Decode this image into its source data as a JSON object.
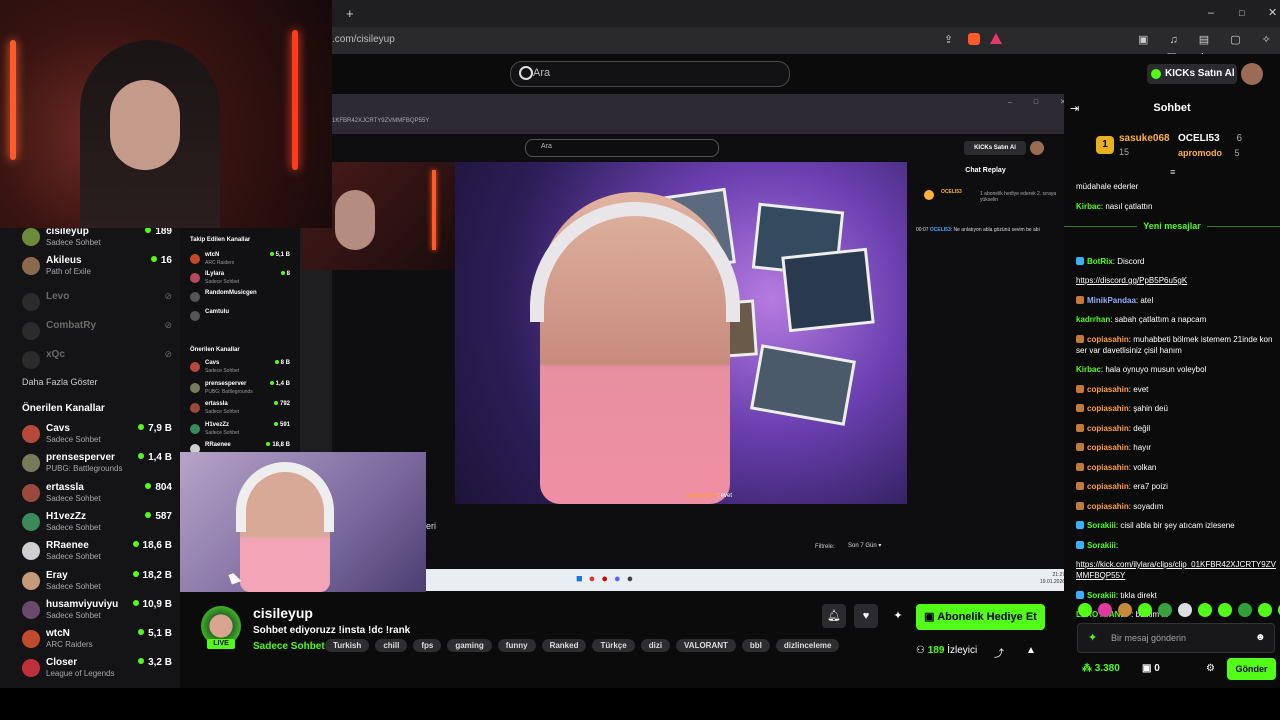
{
  "browser": {
    "url": ".com/cisileyup",
    "win_controls": [
      "–",
      "□",
      "✕"
    ]
  },
  "header": {
    "search_placeholder": "Ara",
    "kicks_label": "KICKs Satın Al"
  },
  "sidebar": {
    "top": [
      {
        "name": "cisileyup",
        "sub": "Sadece Sohbet",
        "count": "189",
        "color": "#6b8a3a"
      },
      {
        "name": "Akileus",
        "sub": "Path of Exile",
        "count": "16",
        "color": "#8a6a4a"
      }
    ],
    "offline": [
      {
        "name": "Levo"
      },
      {
        "name": "CombatRy"
      },
      {
        "name": "xQc"
      }
    ],
    "show_more": "Daha Fazla Göster",
    "recommended_title": "Önerilen Kanallar",
    "recommended": [
      {
        "name": "Cavs",
        "sub": "Sadece Sohbet",
        "count": "7,9 B",
        "color": "#b54a3a"
      },
      {
        "name": "prensesperver",
        "sub": "PUBG: Battlegrounds",
        "count": "1,4 B",
        "color": "#7a7a5a"
      },
      {
        "name": "ertassla",
        "sub": "Sadece Sohbet",
        "count": "804",
        "color": "#9a4a3a"
      },
      {
        "name": "H1vezZz",
        "sub": "Sadece Sohbet",
        "count": "587",
        "color": "#3a8a5a"
      },
      {
        "name": "RRaenee",
        "sub": "Sadece Sohbet",
        "count": "18,6 B",
        "color": "#cfcfcf"
      },
      {
        "name": "Eray",
        "sub": "Sadece Sohbet",
        "count": "18,2 B",
        "color": "#c49a7a"
      },
      {
        "name": "husamviyuviyu",
        "sub": "Sadece Sohbet",
        "count": "10,9 B",
        "color": "#6a4a6a"
      },
      {
        "name": "wtcN",
        "sub": "ARC Raiders",
        "count": "5,1 B",
        "color": "#c04a2a"
      },
      {
        "name": "Closer",
        "sub": "League of Legends",
        "count": "3,2 B",
        "color": "#c0303a"
      }
    ]
  },
  "inner": {
    "url": "1KFBR42XJCRTY9ZVMMFBQP55Y",
    "search_placeholder": "Ara",
    "kicks_label": "KICKs Satın Al",
    "section_following": "Takip Edilen Kanallar",
    "section_recommended": "Önerilen Kanallar",
    "following": [
      {
        "name": "wtcN",
        "sub": "ARC Raiders",
        "count": "5,1 B",
        "color": "#c04a2a"
      },
      {
        "name": "ILylara",
        "sub": "Sadece Sohbet",
        "count": "8",
        "color": "#b54a5a"
      },
      {
        "name": "RandomMusicgen",
        "sub": "",
        "count": "",
        "color": "#555"
      },
      {
        "name": "Camtulu",
        "sub": "",
        "count": "",
        "color": "#555"
      }
    ],
    "recommended": [
      {
        "name": "Cavs",
        "sub": "Sadece Sohbet",
        "count": "8 B",
        "color": "#b54a3a"
      },
      {
        "name": "prensesperver",
        "sub": "PUBG: Battlegrounds",
        "count": "1,4 B",
        "color": "#7a7a5a"
      },
      {
        "name": "ertassla",
        "sub": "Sadece Sohbet",
        "count": "792",
        "color": "#9a4a3a"
      },
      {
        "name": "H1vezZz",
        "sub": "Sadece Sohbet",
        "count": "591",
        "color": "#3a8a5a"
      },
      {
        "name": "RRaenee",
        "sub": "",
        "count": "18,8 B",
        "color": "#cfcfcf"
      }
    ],
    "replay_title": "Chat Replay",
    "replay_user": "OCELI53",
    "replay_note": "1 abonelik hediye ederek 2. sıraya yükselin",
    "replay_time": "00:07",
    "replay_msg": "Ne anlatıyon abla gözünü sevim be abi",
    "video_chat_user": "copiasahin",
    "video_chat_text": ": evet",
    "overlay_text": "eri",
    "filter_label": "Filtrele:",
    "filter_value": "Son 7 Gün",
    "clock": "21:27\n19.01.2026"
  },
  "stream": {
    "channel": "cisileyup",
    "title": "Sohbet ediyoruzz !insta !dc !rank",
    "category": "Sadece Sohbet",
    "live": "LIVE",
    "tags": [
      "Turkish",
      "chill",
      "fps",
      "gaming",
      "funny",
      "Ranked",
      "Türkçe",
      "dizi",
      "VALORANT",
      "bbl",
      "dizlinceleme"
    ],
    "subscribe_label": "Abonelik Hediye Et",
    "viewers": "189",
    "viewers_label": "İzleyici"
  },
  "chat": {
    "title": "Sohbet",
    "gifters": [
      {
        "user": "sasuke068",
        "value": "15"
      },
      {
        "user": "OCELI53",
        "value": "6"
      },
      {
        "user": "apromodo",
        "value": "5"
      }
    ],
    "new_messages": "Yeni mesajlar",
    "messages": [
      {
        "user": "",
        "color": "#fff",
        "text": "müdahale ederler",
        "badge": ""
      },
      {
        "user": "Kirbac",
        "color": "#53fc18",
        "text": "nasıl çatlattın",
        "badge": ""
      },
      {
        "user": "BotRix",
        "color": "#53fc18",
        "text": "Discord",
        "badge": "#3bb0ff"
      },
      {
        "user": "",
        "color": "#fff",
        "text": "https://discord.gg/PpB5P6u5gK",
        "badge": "",
        "link": true
      },
      {
        "user": "MinikPandaa",
        "color": "#8fb0ff",
        "text": "atel",
        "badge": "#c07a3a"
      },
      {
        "user": "kadrrhan",
        "color": "#53fc18",
        "text": "sabah çatlattım a napcam",
        "badge": ""
      },
      {
        "user": "copiasahin",
        "color": "#ff9d3b",
        "text": "muhabbeti bölmek istemem 21inde konser var davetlisiniz çisil hanım",
        "badge": "#c07a3a"
      },
      {
        "user": "Kirbac",
        "color": "#53fc18",
        "text": "hala oynuyo musun voleybol",
        "badge": ""
      },
      {
        "user": "copiasahin",
        "color": "#ff9d3b",
        "text": "evet",
        "badge": "#c07a3a"
      },
      {
        "user": "copiasahin",
        "color": "#ff9d3b",
        "text": "şahin deü",
        "badge": "#c07a3a"
      },
      {
        "user": "copiasahin",
        "color": "#ff9d3b",
        "text": "değil",
        "badge": "#c07a3a"
      },
      {
        "user": "copiasahin",
        "color": "#ff9d3b",
        "text": "hayır",
        "badge": "#c07a3a"
      },
      {
        "user": "copiasahin",
        "color": "#ff9d3b",
        "text": "volkan",
        "badge": "#c07a3a"
      },
      {
        "user": "copiasahin",
        "color": "#ff9d3b",
        "text": "era7 poizi",
        "badge": "#c07a3a"
      },
      {
        "user": "copiasahin",
        "color": "#ff9d3b",
        "text": "soyadım",
        "badge": "#c07a3a"
      },
      {
        "user": "Sorakiii",
        "color": "#53fc18",
        "text": "cisil abla bir şey atıcam izlesene",
        "badge": "#3bb0ff"
      },
      {
        "user": "Sorakiii",
        "color": "#53fc18",
        "text": "",
        "badge": "#3bb0ff"
      },
      {
        "user": "",
        "color": "#fff",
        "text": "https://kick.com/ilylara/clips/clip_01KFBR42XJCRTY9ZVMMFBQP55Y",
        "badge": "",
        "link": true
      },
      {
        "user": "Sorakiii",
        "color": "#53fc18",
        "text": "tıkla direkt",
        "badge": "#3bb0ff"
      },
      {
        "user": "LEROYSANEP",
        "color": "#53fc18",
        "text": "bu kim la",
        "badge": ""
      }
    ],
    "input_placeholder": "Bir mesaj gönderin",
    "points": "3.380",
    "zero": "0",
    "send_label": "Gönder"
  },
  "colors": {
    "accent": "#53fc18",
    "background": "#0b0b0c",
    "panel": "#141416"
  }
}
